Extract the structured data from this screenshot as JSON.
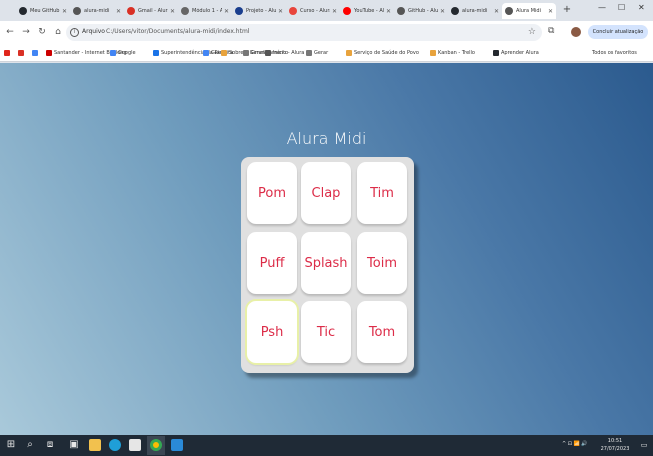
{
  "browser": {
    "tabs": [
      {
        "title": "Meu GitHub",
        "color": "#24292f"
      },
      {
        "title": "alura-midi",
        "color": "#555555"
      },
      {
        "title": "Gmail - Alura",
        "color": "#d93025"
      },
      {
        "title": "Módulo 1 - Alura",
        "color": "#666666"
      },
      {
        "title": "Projeto - Alura",
        "color": "#1a3e8e"
      },
      {
        "title": "Curso - Alura",
        "color": "#e8453c"
      },
      {
        "title": "YouTube - Alura",
        "color": "#ff0000"
      },
      {
        "title": "GitHub - Alura",
        "color": "#555555"
      },
      {
        "title": "alura-midi",
        "color": "#24292f"
      },
      {
        "title": "Alura Midi",
        "color": "#555555",
        "active": true
      }
    ],
    "address": {
      "label": "Arquivo",
      "url": "C:/Users/vitor/Documents/alura-midi/index.html"
    },
    "menu_pill": "Concluir atualização",
    "bookmarks": [
      {
        "label": "",
        "color": "#e0261b"
      },
      {
        "label": "",
        "color": "#d93025"
      },
      {
        "label": "",
        "color": "#4285f4"
      },
      {
        "label": "Santander - Internet Banking",
        "color": "#cc0000"
      },
      {
        "label": "Google",
        "color": "#4285f4"
      },
      {
        "label": "Superintendência da Receita",
        "color": "#1a73e8"
      },
      {
        "label": "Guias",
        "color": "#4285f4"
      },
      {
        "label": "Sobre o Gerenciamento",
        "color": "#e8a33d"
      },
      {
        "label": "Gmail",
        "color": "#777777"
      },
      {
        "label": "Início - Alura",
        "color": "#555555"
      },
      {
        "label": "Gerar",
        "color": "#777777"
      },
      {
        "label": "Serviço de Saúde do Povo",
        "color": "#e8a33d"
      },
      {
        "label": "Kanban - Trello",
        "color": "#e8a33d"
      },
      {
        "label": "Aprender Alura",
        "color": "#24292f"
      }
    ],
    "bookmarks_other": "Todos os favoritos"
  },
  "app": {
    "title": "Alura Midi",
    "keys": [
      "Pom",
      "Clap",
      "Tim",
      "Puff",
      "Splash",
      "Toim",
      "Psh",
      "Tic",
      "Tom"
    ],
    "focused_key": "Psh"
  },
  "taskbar": {
    "tray_text": "^ ⊡ 📶 🔊",
    "time": "10:51",
    "date": "27/07/2023"
  }
}
